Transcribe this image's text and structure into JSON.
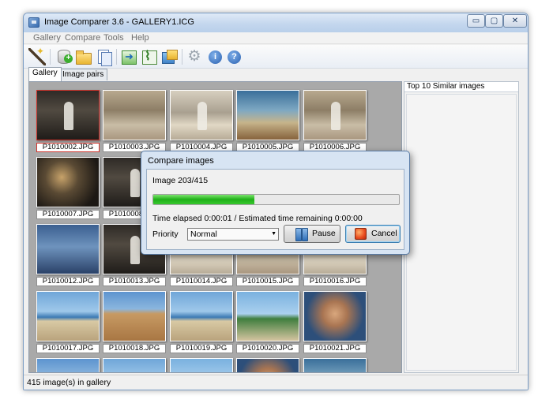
{
  "window": {
    "title": "Image Comparer 3.6 - GALLERY1.ICG",
    "controls": {
      "minimize": "▭",
      "maximize": "▢",
      "close": "✕"
    }
  },
  "menu": [
    "Gallery",
    "Compare",
    "Tools",
    "Help"
  ],
  "toolbar": {
    "icons": [
      "wand-icon",
      "add-database-icon",
      "open-folder-icon",
      "pages-icon",
      "export-icon",
      "chart-icon",
      "images-icon",
      "gear-icon",
      "info-icon",
      "help-icon"
    ],
    "info_glyph": "i",
    "help_glyph": "?"
  },
  "tabs": [
    "Gallery",
    "Image pairs"
  ],
  "gallery": {
    "thumbnails": [
      {
        "caption": "P1010002.JPG",
        "selected": true
      },
      {
        "caption": "P1010003.JPG"
      },
      {
        "caption": "P1010004.JPG"
      },
      {
        "caption": "P1010005.JPG"
      },
      {
        "caption": "P1010006.JPG"
      },
      {
        "caption": "P1010007.JPG"
      },
      {
        "caption": "P1010008.JPG"
      },
      {
        "caption": "P1010012.JPG"
      },
      {
        "caption": "P1010013.JPG"
      },
      {
        "caption": "P1010014.JPG"
      },
      {
        "caption": "P1010015.JPG"
      },
      {
        "caption": "P1010016.JPG"
      },
      {
        "caption": "P1010017.JPG"
      },
      {
        "caption": "P1010018.JPG"
      },
      {
        "caption": "P1010019.JPG"
      },
      {
        "caption": "P1010020.JPG"
      },
      {
        "caption": "P1010021.JPG"
      }
    ]
  },
  "scrollbar": {
    "up": "▲",
    "down": "▼"
  },
  "side_panel": {
    "title": "Top 10 Similar images"
  },
  "status": {
    "text": "415 image(s) in gallery"
  },
  "dialog": {
    "title": "Compare images",
    "image_counter": "Image 203/415",
    "progress_fraction": 0.41,
    "time_text": "Time elapsed  0:00:01 / Estimated time remaining  0:00:00",
    "priority_label": "Priority",
    "priority_value": "Normal",
    "priority_arrow": "▼",
    "pause_label": "Pause",
    "cancel_label": "Cancel"
  },
  "colors": {
    "progress": "#1fb018",
    "selection": "#d0342c",
    "gallery_bg": "#a9a9a9"
  }
}
